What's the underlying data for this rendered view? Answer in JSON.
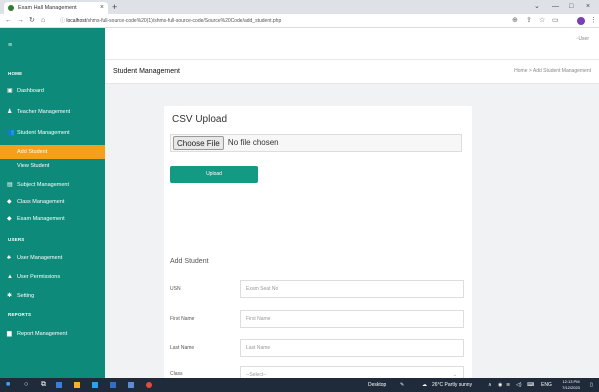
{
  "browser": {
    "tab_title": "Exam Hall Management",
    "tab_close": "×",
    "new_tab": "+",
    "win_min": "—",
    "win_max": "□",
    "win_close": "×",
    "win_chevron": "⌄",
    "back": "←",
    "forward": "→",
    "reload": "↻",
    "home": "⌂",
    "url_host": "localhost",
    "url_path": "/shms-full-source-code%20(1)/shms-full-source-code/Source%20Code/add_student.php"
  },
  "sidebar": {
    "toggle": "≡",
    "section_home": "HOME",
    "section_users": "USERS",
    "section_reports": "REPORTS",
    "items": {
      "dashboard": "Dashboard",
      "teacher_management": "Teacher Management",
      "student_management": "Student Management",
      "add_student": "Add Student",
      "view_student": "View Student",
      "subject_management": "Subject Management",
      "class_management": "Class Management",
      "exam_management": "Exam Management",
      "user_management": "User Management",
      "user_permissions": "User Permissions",
      "setting": "Setting",
      "report_management": "Report Management"
    }
  },
  "topbar": {
    "user_label": "User"
  },
  "page": {
    "title": "Student Management",
    "breadcrumb": "Home  >  Add Student Management"
  },
  "csv_card": {
    "title": "CSV Upload",
    "file_button": "Choose File",
    "file_status": "No file chosen",
    "upload_button": "Upload"
  },
  "add_card": {
    "subtitle": "Add Student",
    "fields": {
      "usn_label": "USN",
      "usn_placeholder": "Exam Seat No",
      "first_label": "First Name",
      "first_placeholder": "First Name",
      "last_label": "Last Name",
      "last_placeholder": "Last Name",
      "class_label": "Class",
      "class_value": "--Select--"
    }
  },
  "taskbar": {
    "desktop": "Desktop",
    "weather": "26°C  Partly sunny",
    "lang": "ENG",
    "time": "12:13 PM",
    "date": "7/12/2023"
  }
}
